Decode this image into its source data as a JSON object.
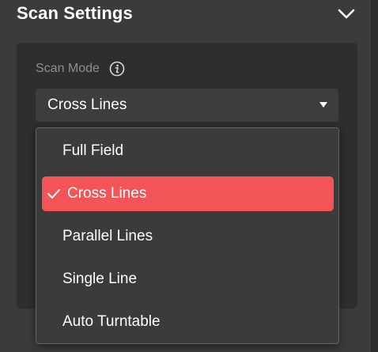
{
  "header": {
    "title": "Scan Settings",
    "collapse_icon": "chevron-down-icon"
  },
  "scan_mode": {
    "label": "Scan Mode",
    "info_icon": "info-icon",
    "selected_value": "Cross Lines",
    "caret_icon": "caret-down-icon"
  },
  "dropdown": {
    "options": [
      {
        "label": "Full Field",
        "selected": false
      },
      {
        "label": "Cross Lines",
        "selected": true
      },
      {
        "label": "Parallel Lines",
        "selected": false
      },
      {
        "label": "Single Line",
        "selected": false
      },
      {
        "label": "Auto Turntable",
        "selected": false
      }
    ],
    "check_icon": "check-icon"
  },
  "colors": {
    "accent": "#f25458",
    "background": "#3b3b3b",
    "panel": "#2e2e2e",
    "text": "#ffffff",
    "muted_text": "#8d8d8d"
  }
}
